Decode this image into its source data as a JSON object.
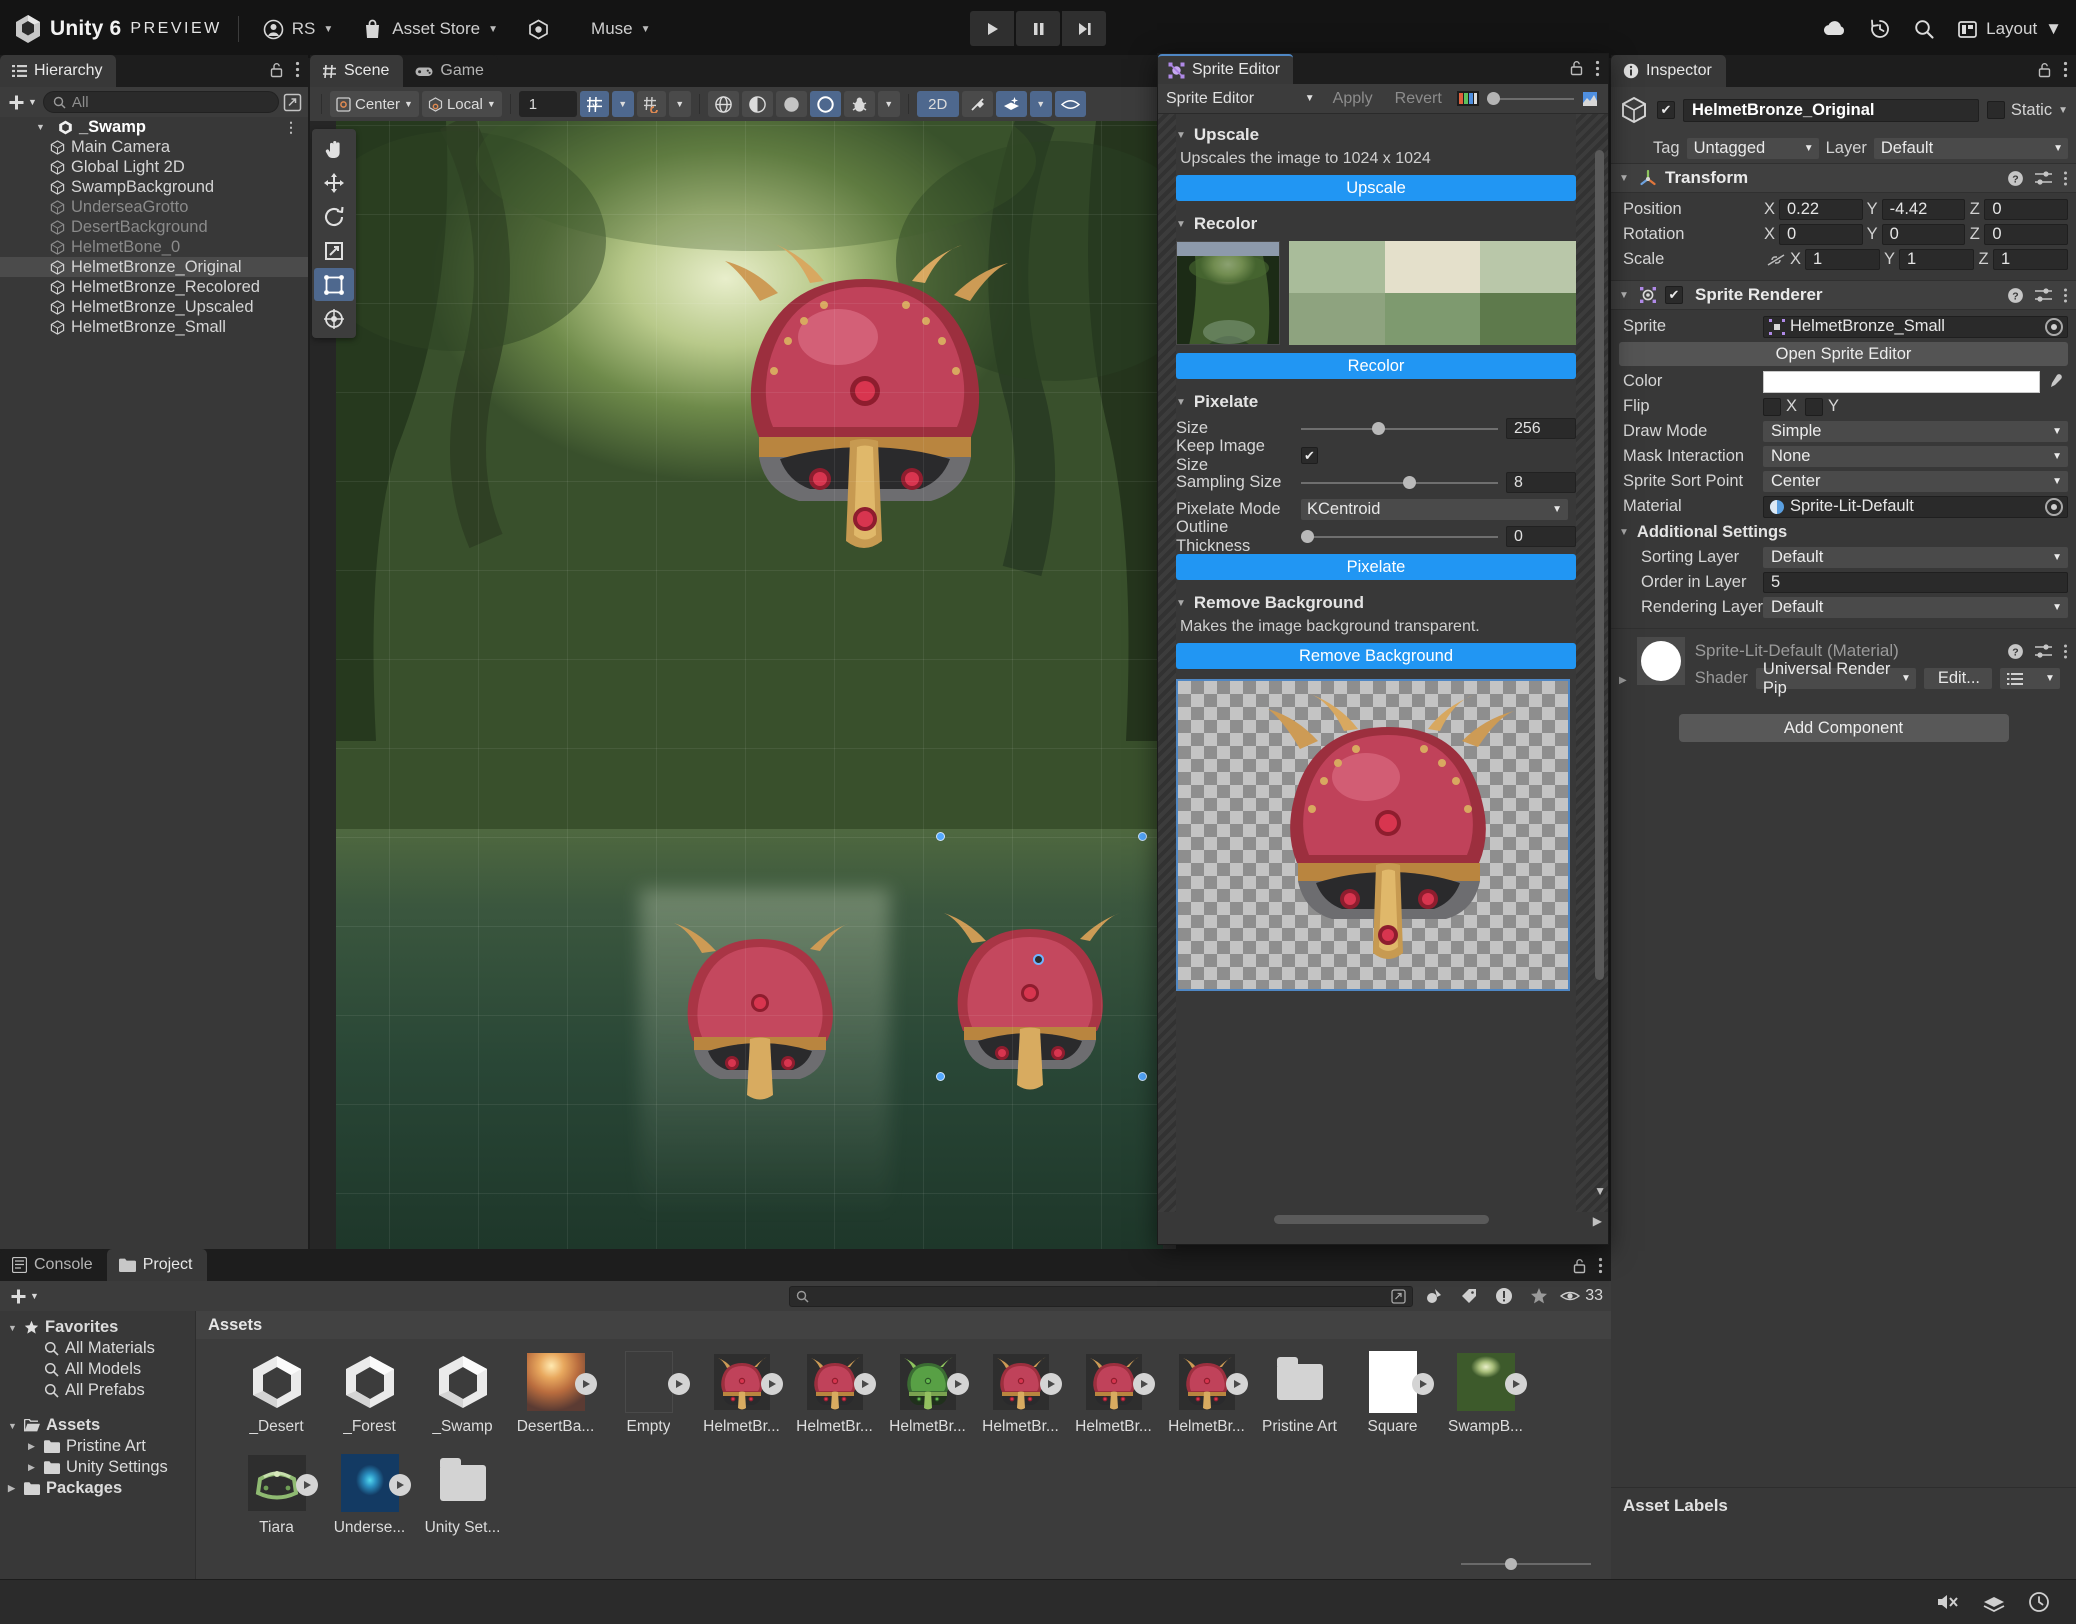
{
  "topbar": {
    "brand_name": "Unity 6",
    "brand_tag": "PREVIEW",
    "account": "RS",
    "asset_store": "Asset Store",
    "muse": "Muse",
    "cloud_icon": "cloud-icon",
    "history_icon": "history-icon",
    "search_icon": "search-icon",
    "layout_label": "Layout",
    "play_icon": "play-icon",
    "pause_icon": "pause-icon",
    "step_icon": "step-icon"
  },
  "hierarchy": {
    "tab_label": "Hierarchy",
    "add_label": "+",
    "search_placeholder": "All",
    "items": [
      {
        "label": "_Swamp",
        "level": 0,
        "dim": false,
        "selected": false,
        "expanded": true
      },
      {
        "label": "Main Camera",
        "level": 1,
        "dim": false,
        "selected": false
      },
      {
        "label": "Global Light 2D",
        "level": 1,
        "dim": false,
        "selected": false
      },
      {
        "label": "SwampBackground",
        "level": 1,
        "dim": false,
        "selected": false
      },
      {
        "label": "UnderseaGrotto",
        "level": 1,
        "dim": true,
        "selected": false
      },
      {
        "label": "DesertBackground",
        "level": 1,
        "dim": true,
        "selected": false
      },
      {
        "label": "HelmetBone_0",
        "level": 1,
        "dim": true,
        "selected": false
      },
      {
        "label": "HelmetBronze_Original",
        "level": 1,
        "dim": false,
        "selected": true
      },
      {
        "label": "HelmetBronze_Recolored",
        "level": 1,
        "dim": false,
        "selected": false
      },
      {
        "label": "HelmetBronze_Upscaled",
        "level": 1,
        "dim": false,
        "selected": false
      },
      {
        "label": "HelmetBronze_Small",
        "level": 1,
        "dim": false,
        "selected": false
      }
    ]
  },
  "scene": {
    "tab_scene": "Scene",
    "tab_game": "Game",
    "pivot_mode": "Center",
    "handle_space": "Local",
    "grid_size": "1",
    "mode_2d": "2D"
  },
  "sprite_editor": {
    "tab_label": "Sprite Editor",
    "mode_dropdown": "Sprite Editor",
    "apply_label": "Apply",
    "revert_label": "Revert",
    "upscale": {
      "title": "Upscale",
      "description": "Upscales the image to 1024 x 1024",
      "button": "Upscale"
    },
    "recolor": {
      "title": "Recolor",
      "button": "Recolor",
      "palette": [
        "#a9bc9a",
        "#e4e0cb",
        "#b9c7a9",
        "#8ea37f",
        "#7e9a6f",
        "#5e7a4c"
      ]
    },
    "pixelate": {
      "title": "Pixelate",
      "size_label": "Size",
      "size_value": "256",
      "keep_image_size_label": "Keep Image Size",
      "keep_image_size_checked": true,
      "sampling_size_label": "Sampling Size",
      "sampling_size_value": "8",
      "pixelate_mode_label": "Pixelate Mode",
      "pixelate_mode_value": "KCentroid",
      "outline_thickness_label": "Outline Thickness",
      "outline_thickness_value": "0",
      "button": "Pixelate"
    },
    "remove_background": {
      "title": "Remove Background",
      "description": "Makes the image background transparent.",
      "button": "Remove Background"
    }
  },
  "inspector": {
    "tab_label": "Inspector",
    "object_name": "HelmetBronze_Original",
    "object_enabled": true,
    "static_label": "Static",
    "tag_label": "Tag",
    "tag_value": "Untagged",
    "layer_label": "Layer",
    "layer_value": "Default",
    "transform": {
      "title": "Transform",
      "position_label": "Position",
      "position": {
        "x": "0.22",
        "y": "-4.42",
        "z": "0"
      },
      "rotation_label": "Rotation",
      "rotation": {
        "x": "0",
        "y": "0",
        "z": "0"
      },
      "scale_label": "Scale",
      "scale": {
        "x": "1",
        "y": "1",
        "z": "1"
      }
    },
    "sprite_renderer": {
      "title": "Sprite Renderer",
      "enabled": true,
      "sprite_label": "Sprite",
      "sprite_value": "HelmetBronze_Small",
      "open_sprite_editor": "Open Sprite Editor",
      "color_label": "Color",
      "color_value": "#ffffff",
      "flip_label": "Flip",
      "flip_x_label": "X",
      "flip_y_label": "Y",
      "draw_mode_label": "Draw Mode",
      "draw_mode_value": "Simple",
      "mask_interaction_label": "Mask Interaction",
      "mask_interaction_value": "None",
      "sprite_sort_point_label": "Sprite Sort Point",
      "sprite_sort_point_value": "Center",
      "material_label": "Material",
      "material_value": "Sprite-Lit-Default",
      "additional_settings_label": "Additional Settings",
      "sorting_layer_label": "Sorting Layer",
      "sorting_layer_value": "Default",
      "order_in_layer_label": "Order in Layer",
      "order_in_layer_value": "5",
      "rendering_layer_label": "Rendering Layer M",
      "rendering_layer_value": "Default"
    },
    "material_preview": {
      "title": "Sprite-Lit-Default (Material)",
      "shader_label": "Shader",
      "shader_value": "Universal Render Pip",
      "edit_label": "Edit..."
    },
    "add_component": "Add Component",
    "asset_labels": "Asset Labels"
  },
  "project": {
    "tab_console": "Console",
    "tab_project": "Project",
    "search_placeholder": "",
    "visible_count": "33",
    "assets_header": "Assets",
    "tree": [
      {
        "label": "Favorites",
        "kind": "star",
        "bold": true,
        "indent": 0,
        "caret": "down"
      },
      {
        "label": "All Materials",
        "kind": "search",
        "bold": false,
        "indent": 1
      },
      {
        "label": "All Models",
        "kind": "search",
        "bold": false,
        "indent": 1
      },
      {
        "label": "All Prefabs",
        "kind": "search",
        "bold": false,
        "indent": 1
      },
      {
        "label": "",
        "kind": "spacer",
        "bold": false,
        "indent": 0
      },
      {
        "label": "Assets",
        "kind": "folder-open",
        "bold": true,
        "indent": 0,
        "caret": "down"
      },
      {
        "label": "Pristine Art",
        "kind": "folder",
        "bold": false,
        "indent": 1,
        "caret": "right"
      },
      {
        "label": "Unity Settings",
        "kind": "folder",
        "bold": false,
        "indent": 1,
        "caret": "right"
      },
      {
        "label": "Packages",
        "kind": "folder",
        "bold": true,
        "indent": 0,
        "caret": "right"
      }
    ],
    "assets": [
      {
        "name": "_Desert",
        "kind": "unity",
        "badge": false
      },
      {
        "name": "_Forest",
        "kind": "unity",
        "badge": false
      },
      {
        "name": "_Swamp",
        "kind": "unity",
        "badge": false
      },
      {
        "name": "DesertBa...",
        "kind": "image-desert",
        "badge": true
      },
      {
        "name": "Empty",
        "kind": "empty",
        "badge": true
      },
      {
        "name": "HelmetBr...",
        "kind": "helmet-red",
        "badge": true
      },
      {
        "name": "HelmetBr...",
        "kind": "helmet-red",
        "badge": true
      },
      {
        "name": "HelmetBr...",
        "kind": "helmet-green",
        "badge": true
      },
      {
        "name": "HelmetBr...",
        "kind": "helmet-red",
        "badge": true
      },
      {
        "name": "HelmetBr...",
        "kind": "helmet-red",
        "badge": true
      },
      {
        "name": "HelmetBr...",
        "kind": "helmet-red",
        "badge": true
      },
      {
        "name": "Pristine Art",
        "kind": "folder",
        "badge": false
      },
      {
        "name": "Square",
        "kind": "white",
        "badge": true
      },
      {
        "name": "SwampB...",
        "kind": "image-swamp",
        "badge": true
      },
      {
        "name": "Tiara",
        "kind": "tiara",
        "badge": true
      },
      {
        "name": "Underse...",
        "kind": "image-grotto",
        "badge": true
      },
      {
        "name": "Unity Set...",
        "kind": "folder",
        "badge": false
      }
    ]
  }
}
